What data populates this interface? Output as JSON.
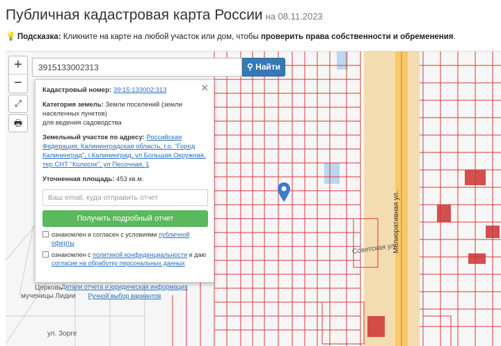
{
  "header": {
    "title": "Публичная кадастровая карта России",
    "date": "на 08.11.2023"
  },
  "hint": {
    "prefix": "Подсказка:",
    "text": " Кликните на карте на любой участок или дом, чтобы ",
    "bold": "проверить права собственности и обременения",
    "suffix": "."
  },
  "search": {
    "value": "3915133002313",
    "button": "Найти"
  },
  "popup": {
    "cad_label": "Кадастровый номер:",
    "cad_value": "39:15:133002:313",
    "cat_label": "Категория земель:",
    "cat_value": " Земли поселений (земли населенных пунктов)",
    "use_value": "для ведения садоводства",
    "addr_label": "Земельный участок по адресу:",
    "addr_value": "Российская Федерация, Калининградская область, г.о. \"Город Калининград\", г.Калининград, ул Большая Окружная, тер СНТ \"Колосок\", ул Песочная, 1",
    "area_label": "Уточненная площадь:",
    "area_value": " 453 кв.м.",
    "email_placeholder": "Ваш email, куда отправить отчет",
    "get_button": "Получить подробный отчет",
    "agree1_text": "ознакомлен и согласен с условиями ",
    "agree1_link": "публичной оферты",
    "agree2_text": "ознакомлен с ",
    "agree2_link1": "политикой конфиденциальности",
    "agree2_mid": " и даю ",
    "agree2_link2": "согласие на обработку персональных данных",
    "details_link": "Детали отчета и юридическая информация",
    "manual_link": "Ручной выбор вариантов"
  },
  "map_labels": {
    "street1": "Мелиоративная ул.",
    "church1": "Церковь",
    "church2": "мученицы Лидии",
    "street2": "Советская ул",
    "street3": "ул. Зорге"
  }
}
